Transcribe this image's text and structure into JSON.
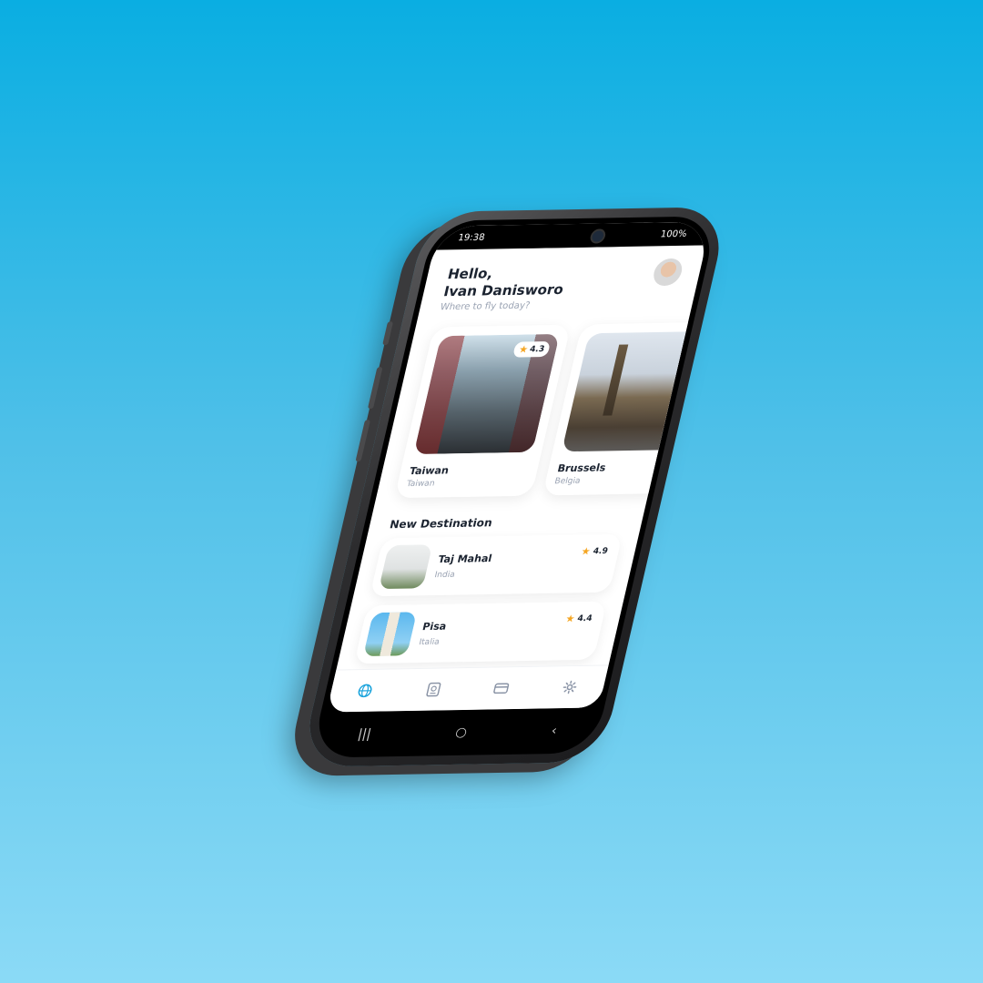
{
  "status_bar": {
    "time": "19:38",
    "battery": "100%"
  },
  "header": {
    "greeting_line1": "Hello,",
    "greeting_line2": "Ivan Danisworo",
    "subtitle": "Where to fly today?"
  },
  "featured": [
    {
      "title": "Taiwan",
      "subtitle": "Taiwan",
      "rating": "4.3"
    },
    {
      "title": "Brussels",
      "subtitle": "Belgia",
      "rating": ""
    }
  ],
  "new_destination": {
    "title": "New Destination",
    "items": [
      {
        "title": "Taj Mahal",
        "subtitle": "India",
        "rating": "4.9"
      },
      {
        "title": "Pisa",
        "subtitle": "Italia",
        "rating": "4.4"
      }
    ]
  },
  "tabbar": {
    "active_color": "#1aa3dc",
    "inactive_color": "#8a94a6",
    "items": [
      "globe-icon",
      "passport-icon",
      "card-icon",
      "gear-icon"
    ]
  },
  "accent": {
    "star": "#f5a623"
  }
}
